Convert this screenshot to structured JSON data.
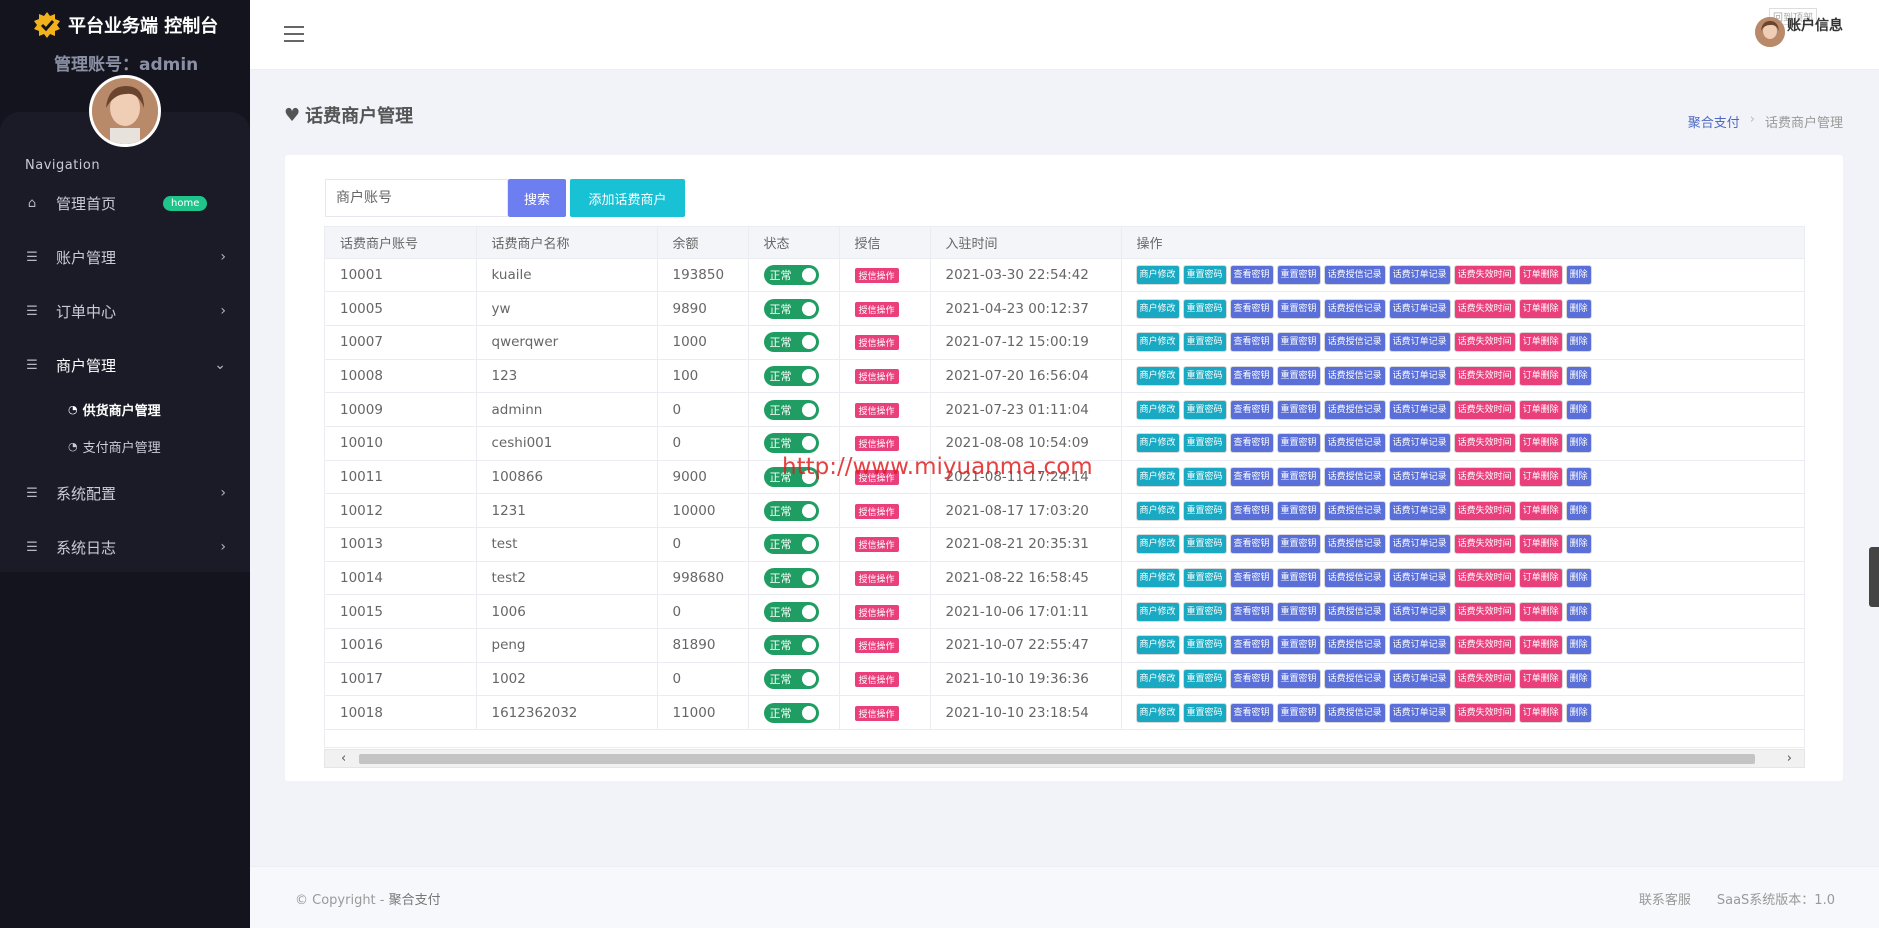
{
  "brand": {
    "title": "平台业务端 控制台",
    "admin_line": "管理账号：admin"
  },
  "sidebar": {
    "nav_title": "Navigation",
    "items": [
      {
        "label": "管理首页",
        "icon": "home-icon",
        "badge": "home"
      },
      {
        "label": "账户管理",
        "icon": "list-icon"
      },
      {
        "label": "订单中心",
        "icon": "list-icon"
      },
      {
        "label": "商户管理",
        "icon": "list-icon",
        "expanded": true
      },
      {
        "label": "系统配置",
        "icon": "list-icon"
      },
      {
        "label": "系统日志",
        "icon": "list-icon"
      }
    ],
    "sub_items": [
      {
        "label": "供货商户管理",
        "active": true
      },
      {
        "label": "支付商户管理",
        "active": false
      }
    ]
  },
  "topbar": {
    "account_label": "账户信息",
    "ghost_tag": "回到顶部"
  },
  "page": {
    "title": "话费商户管理",
    "breadcrumb": {
      "link": "聚合支付",
      "sep": "›",
      "current": "话费商户管理"
    }
  },
  "search": {
    "placeholder": "商户账号",
    "search_label": "搜索",
    "add_label": "添加话费商户"
  },
  "table": {
    "headers": [
      "话费商户账号",
      "话费商户名称",
      "余额",
      "状态",
      "授信",
      "入驻时间",
      "操作"
    ],
    "status_label": "正常",
    "credit_label": "授信操作",
    "op_labels": [
      "商户修改",
      "重置密码",
      "查看密钥",
      "重置密钥",
      "话费授信记录",
      "话费订单记录",
      "话费失效时间",
      "订单删除",
      "删除"
    ],
    "rows": [
      {
        "id": "10001",
        "name": "kuaile",
        "balance": "193850",
        "time": "2021-03-30 22:54:42"
      },
      {
        "id": "10005",
        "name": "yw",
        "balance": "9890",
        "time": "2021-04-23 00:12:37"
      },
      {
        "id": "10007",
        "name": "qwerqwer",
        "balance": "1000",
        "time": "2021-07-12 15:00:19"
      },
      {
        "id": "10008",
        "name": "123",
        "balance": "100",
        "time": "2021-07-20 16:56:04"
      },
      {
        "id": "10009",
        "name": "adminn",
        "balance": "0",
        "time": "2021-07-23 01:11:04"
      },
      {
        "id": "10010",
        "name": "ceshi001",
        "balance": "0",
        "time": "2021-08-08 10:54:09"
      },
      {
        "id": "10011",
        "name": "100866",
        "balance": "9000",
        "time": "2021-08-11 17:24:14"
      },
      {
        "id": "10012",
        "name": "1231",
        "balance": "10000",
        "time": "2021-08-17 17:03:20"
      },
      {
        "id": "10013",
        "name": "test",
        "balance": "0",
        "time": "2021-08-21 20:35:31"
      },
      {
        "id": "10014",
        "name": "test2",
        "balance": "998680",
        "time": "2021-08-22 16:58:45"
      },
      {
        "id": "10015",
        "name": "1006",
        "balance": "0",
        "time": "2021-10-06 17:01:11"
      },
      {
        "id": "10016",
        "name": "peng",
        "balance": "81890",
        "time": "2021-10-07 22:55:47"
      },
      {
        "id": "10017",
        "name": "1002",
        "balance": "0",
        "time": "2021-10-10 19:36:36"
      },
      {
        "id": "10018",
        "name": "1612362032",
        "balance": "11000",
        "time": "2021-10-10 23:18:54"
      }
    ]
  },
  "watermark": "http://www.miyuanma.com",
  "footer": {
    "copyright": "© Copyright - ",
    "brand": "聚合支付",
    "contact": "联系客服",
    "version": "SaaS系统版本：1.0"
  },
  "colors": {
    "sidebar_bg": "#1b1b28",
    "primary": "#6c7ef0",
    "teal": "#19c1d5",
    "pink": "#e9407b",
    "green": "#1f9d62"
  }
}
